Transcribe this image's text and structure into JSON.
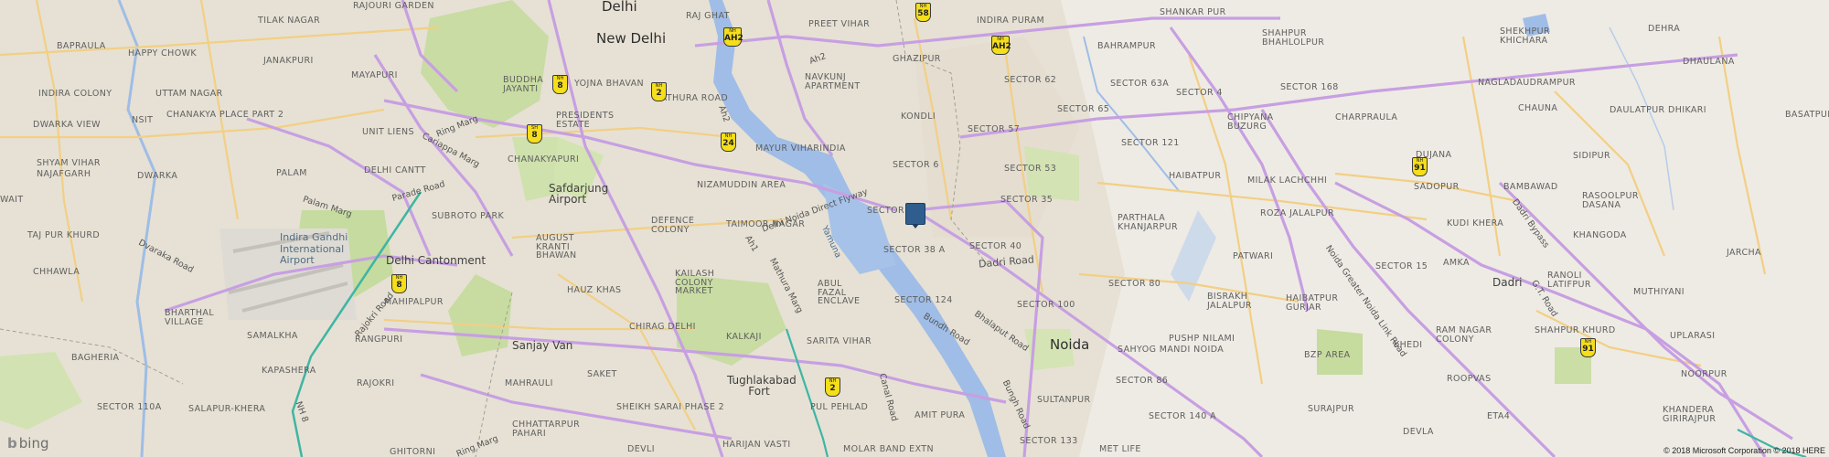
{
  "map": {
    "marker_icon": "location-marker-icon",
    "colors": {
      "background": "#ede9e1",
      "water": "#9fbde6",
      "park": "#c7dca0",
      "urban": "#e6e1d5",
      "highway": "#c59fe0",
      "arterial": "#f3d28a",
      "marker": "#2f5e8e"
    },
    "labels": {
      "delhi": "Delhi",
      "new_delhi": "New Delhi",
      "noida": "Noida",
      "dadri": "Dadri",
      "delhi_cantonment": "Delhi Cantonment",
      "airport": "Indira Gandhi International Airport",
      "sanjay_van": "Sanjay Van",
      "tughlakabad_fort": "Tughlakabad Fort",
      "safdarjung_airport": "Safdarjung Airport",
      "tilak_nagar": "TILAK NAGAR",
      "rajouri_garden": "RAJOURI GARDEN",
      "bapraula": "BAPRAULA",
      "happy_chowk": "HAPPY CHOWK",
      "janakpuri": "JANAKPURI",
      "mayapuri": "MAYAPURI",
      "buddha_jayanti": "BUDDHA JAYANTI",
      "indira_colony": "INDIRA COLONY",
      "uttam_nagar": "UTTAM NAGAR",
      "dwarka_view": "DWARKA VIEW",
      "chanakya_place": "CHANAKYA PLACE PART 2",
      "nsit": "NSIT",
      "unit_liens": "UNIT LIENS",
      "shyam_vihar": "SHYAM VIHAR",
      "najafgarh": "NAJAFGARH",
      "dwarka": "DWARKA",
      "wait": "WAIT",
      "palam": "PALAM",
      "delhi_cantt": "DELHI CANTT",
      "chanakyapuri": "CHANAKYAPURI",
      "presidents_estate": "PRESIDENTS ESTATE",
      "yojna_bhavan": "YOJNA BHAVAN",
      "mathura_road": "MATHURA ROAD",
      "raj_ghat": "RAJ GHAT",
      "preet_vihar": "PREET VIHAR",
      "indira_puram": "INDIRA PURAM",
      "shankar_pur": "SHANKAR PUR",
      "ghazipur": "GHAZIPUR",
      "bahrampur": "BAHRAMPUR",
      "navkunj": "NAVKUNJ APARTMENT",
      "kondli": "KONDLI",
      "sector_62": "SECTOR 62",
      "sector_63a": "SECTOR 63A",
      "sector_65": "SECTOR 65",
      "sector_57": "SECTOR 57",
      "sector_121": "SECTOR 121",
      "sector_6": "SECTOR 6",
      "sector_53": "SECTOR 53",
      "sector_35": "SECTOR 35",
      "sector_left": "SECTOR",
      "sector_38a": "SECTOR 38 A",
      "sector_40": "SECTOR 40",
      "sector_4": "SECTOR 4",
      "sector_168": "SECTOR 168",
      "sector_80": "SECTOR 80",
      "sector_100": "SECTOR 100",
      "sector_124": "SECTOR 124",
      "sector_86": "SECTOR 86",
      "sector_140a": "SECTOR 140 A",
      "sector_133": "SECTOR 133",
      "sector_15": "SECTOR 15",
      "mayur_vihar": "MAYUR VIHARINDIA",
      "nizamuddin": "NIZAMUDDIN AREA",
      "defence_colony": "DEFENCE COLONY",
      "taimoor_nagar": "TAIMOOR NAGAR",
      "subroto_park": "SUBROTO PARK",
      "august_kranti": "AUGUST KRANTI BHAWAN",
      "hauz_khas": "HAUZ KHAS",
      "kailash_colony": "KAILASH COLONY MARKET",
      "abul_fazal": "ABUL FAZAL ENCLAVE",
      "chirag_delhi": "CHIRAG DELHI",
      "kalkaji": "KALKAJI",
      "sarita_vihar": "SARITA VIHAR",
      "saket": "SAKET",
      "mahrauli": "MAHRAULI",
      "sheikh_sarai": "SHEIKH SARAI PHASE 2",
      "pul_pehlad": "PUL PEHLAD",
      "amit_pura": "AMIT PURA",
      "harijan_vasti": "HARIJAN VASTI",
      "molar_band": "MOLAR BAND EXTN",
      "devli": "DEVLI",
      "chhattarpur": "CHHATTARPUR PAHARI",
      "ghitorni": "GHITORNI",
      "rajokri": "RAJOKRI",
      "rangpuri": "RANGPURI",
      "mahipalpur": "MAHIPALPUR",
      "chhawla": "CHHAWLA",
      "tajpur_khurd": "TAJ PUR KHURD",
      "bharthal": "BHARTHAL VILLAGE",
      "samalkha": "SAMALKHA",
      "bagheria": "BAGHERIA",
      "kapashera": "KAPASHERA",
      "sector_110a": "SECTOR 110A",
      "salapur_khera": "SALAPUR-KHERA",
      "sultanpur": "SULTANPUR",
      "met_life": "MET LIFE",
      "bisrakh": "BISRAKH JALALPUR",
      "haibatpur_gurjar": "HAIBATPUR GURJAR",
      "pushp_nilami": "PUSHP NILAMI",
      "sahyog_mandi": "SAHYOG MANDI NOIDA",
      "parthala": "PARTHALA KHANJARPUR",
      "haibatpur": "HAIBATPUR",
      "patwari": "PATWARI",
      "roza_jalalpur": "ROZA JALALPUR",
      "milak_lachchhi": "MILAK LACHCHHI",
      "chipyana": "CHIPYANA BUZURG",
      "charpraula": "CHARPRAULA",
      "shahpur_bhahlolpur": "SHAHPUR BHAHLOLPUR",
      "shekhpur": "SHEKHPUR KHICHARA",
      "nagladaudrampur": "NAGLADAUDRAMPUR",
      "chauna": "CHAUNA",
      "daulatpur": "DAULATPUR DHIKARI",
      "dhaulana": "DHAULANA",
      "dehra": "DEHRA",
      "basatpur": "BASATPUR",
      "sidipur": "SIDIPUR",
      "sadopur": "SADOPUR",
      "dujana": "DUJANA",
      "bambawad": "BAMBAWAD",
      "rasoolpur": "RASOOLPUR DASANA",
      "kudi_khera": "KUDI KHERA",
      "khangoda": "KHANGODA",
      "jarcha": "JARCHA",
      "amka": "AMKA",
      "ranoli": "RANOLI LATIFPUR",
      "muthiyani": "MUTHIYANI",
      "shahpur_khurd": "SHAHPUR KHURD",
      "ram_nagar": "RAM NAGAR COLONY",
      "uplarasi": "UPLARASI",
      "khedi": "KHEDI",
      "bzp_area": "BZP AREA",
      "roopvas": "ROOPVAS",
      "noorpur": "NOORPUR",
      "surajpur": "SURAJPUR",
      "eta4": "ETA4",
      "devla": "DEVLA",
      "khandera": "KHANDERA GIRIRAJPUR",
      "ah2": "Ah2",
      "ah1": "Ah1",
      "mathura_marg": "Mathura Marg",
      "ring_marg": "Ring Marg",
      "cariappa_marg": "Cariappa Marg",
      "parade_road": "Parade Road",
      "palam_marg": "Palam Marg",
      "dvaraka_road": "Dvaraka Road",
      "dadri_road": "Dadri Road",
      "bundh_road": "Bundh Road",
      "bhalaput_road": "Bhalaput Road",
      "canal_road": "Canal Road",
      "bungh_road": "Bungh Road",
      "noida_greater_link": "Noida Greater Noida Link Road",
      "dadri_bypass": "Dadri Bypass",
      "gt_road": "G.T. Road",
      "dnd_flyway": "Delhi Noida Direct Flyway",
      "yamuna": "Yamuna",
      "ring_marg_bottom": "Ring Marg",
      "nh8_road": "NH 8",
      "rajokri_road": "Rajokri Road"
    },
    "shields": {
      "s58_top": "58",
      "ah2_a": "AH2",
      "ah2_b": "AH2",
      "nh8_a": "8",
      "nh2_a": "2",
      "nh8_b": "8",
      "nh24": "24",
      "nh8_c": "8",
      "nh2_b": "2",
      "nh91_a": "91",
      "nh91_b": "91",
      "prefix_nh": "NH",
      "prefix_sh": "SH"
    }
  },
  "branding": {
    "logo_text": "bing",
    "logo_icon": "bing-logo-icon",
    "copyright": "© 2018 Microsoft Corporation © 2018 HERE"
  }
}
